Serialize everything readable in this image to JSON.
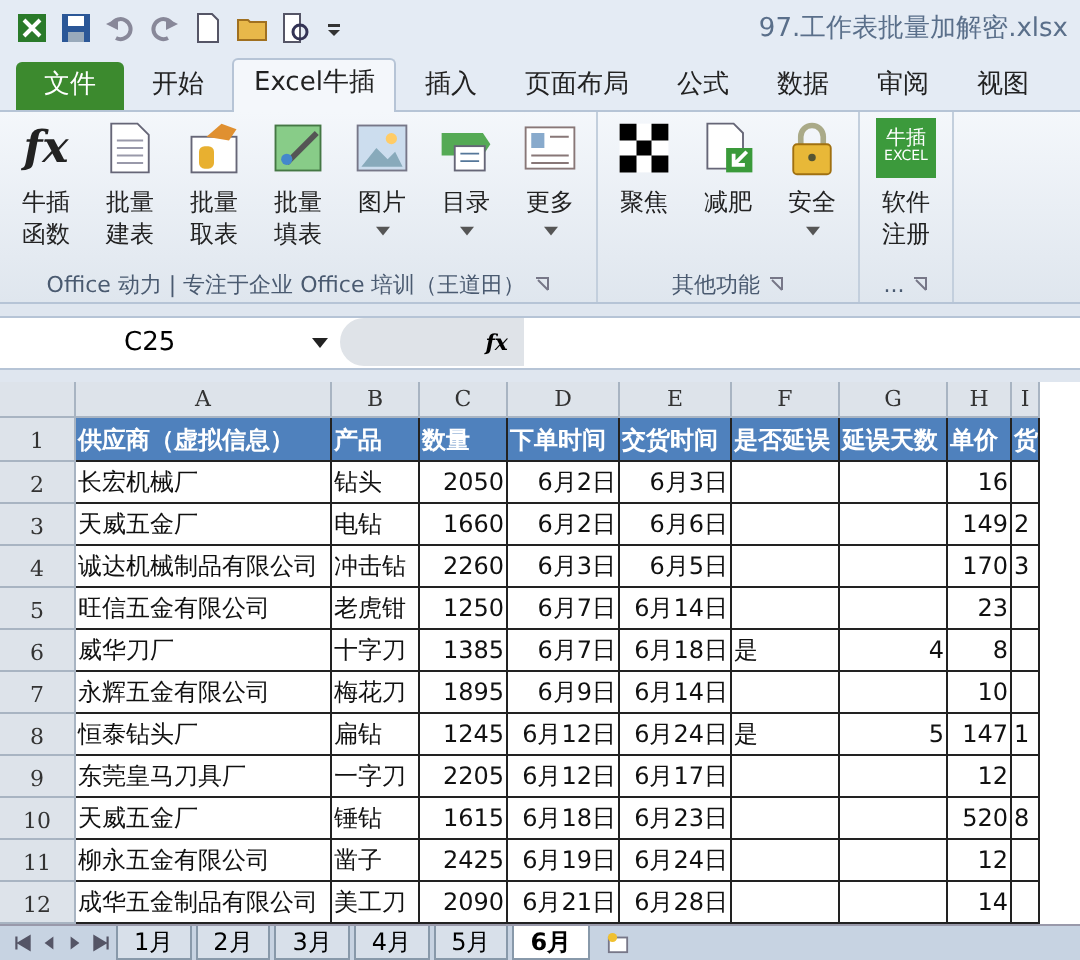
{
  "window": {
    "title": "97.工作表批量加解密.xlsx"
  },
  "tabs": [
    {
      "label": "文件",
      "kind": "file",
      "selected": false
    },
    {
      "label": "开始",
      "kind": "tab",
      "selected": false
    },
    {
      "label": "Excel牛插",
      "kind": "tab",
      "selected": true
    },
    {
      "label": "插入",
      "kind": "tab",
      "selected": false
    },
    {
      "label": "页面布局",
      "kind": "tab",
      "selected": false
    },
    {
      "label": "公式",
      "kind": "tab",
      "selected": false
    },
    {
      "label": "数据",
      "kind": "tab",
      "selected": false
    },
    {
      "label": "审阅",
      "kind": "tab",
      "selected": false
    },
    {
      "label": "视图",
      "kind": "tab",
      "selected": false
    }
  ],
  "ribbon": {
    "groups": [
      {
        "label": "Office 动力 | 专注于企业 Office 培训（王道田）",
        "buttons": [
          {
            "lines": [
              "牛插",
              "函数"
            ],
            "icon_text": "fx",
            "dropdown": false
          },
          {
            "lines": [
              "批量",
              "建表"
            ],
            "dropdown": false
          },
          {
            "lines": [
              "批量",
              "取表"
            ],
            "dropdown": false
          },
          {
            "lines": [
              "批量",
              "填表"
            ],
            "dropdown": false
          },
          {
            "lines": [
              "图片"
            ],
            "dropdown": true
          },
          {
            "lines": [
              "目录"
            ],
            "dropdown": true
          },
          {
            "lines": [
              "更多"
            ],
            "dropdown": true
          }
        ]
      },
      {
        "label": "其他功能",
        "buttons": [
          {
            "lines": [
              "聚焦"
            ],
            "dropdown": false
          },
          {
            "lines": [
              "减肥"
            ],
            "dropdown": false
          },
          {
            "lines": [
              "安全"
            ],
            "dropdown": true
          }
        ]
      },
      {
        "label": "...",
        "buttons": [
          {
            "lines": [
              "软件",
              "注册"
            ],
            "logo_text": [
              "牛插",
              "EXCEL"
            ],
            "dropdown": false
          }
        ]
      }
    ]
  },
  "formula_bar": {
    "name_box": "C25",
    "fx": "fx"
  },
  "sheet": {
    "columns": [
      "A",
      "B",
      "C",
      "D",
      "E",
      "F",
      "G",
      "H",
      "I"
    ],
    "header": [
      "供应商（虚拟信息）",
      "产品",
      "数量",
      "下单时间",
      "交货时间",
      "是否延误",
      "延误天数",
      "单价",
      "货"
    ],
    "header_number": "1",
    "rows": [
      {
        "number": "2",
        "cells": [
          "长宏机械厂",
          "钻头",
          "2050",
          "6月2日",
          "6月3日",
          "",
          "",
          "16",
          ""
        ]
      },
      {
        "number": "3",
        "cells": [
          "天威五金厂",
          "电钻",
          "1660",
          "6月2日",
          "6月6日",
          "",
          "",
          "149",
          "2"
        ]
      },
      {
        "number": "4",
        "cells": [
          "诚达机械制品有限公司",
          "冲击钻",
          "2260",
          "6月3日",
          "6月5日",
          "",
          "",
          "170",
          "3"
        ]
      },
      {
        "number": "5",
        "cells": [
          "旺信五金有限公司",
          "老虎钳",
          "1250",
          "6月7日",
          "6月14日",
          "",
          "",
          "23",
          ""
        ]
      },
      {
        "number": "6",
        "cells": [
          "威华刀厂",
          "十字刀",
          "1385",
          "6月7日",
          "6月18日",
          "是",
          "4",
          "8",
          ""
        ]
      },
      {
        "number": "7",
        "cells": [
          "永辉五金有限公司",
          "梅花刀",
          "1895",
          "6月9日",
          "6月14日",
          "",
          "",
          "10",
          ""
        ]
      },
      {
        "number": "8",
        "cells": [
          "恒泰钻头厂",
          "扁钻",
          "1245",
          "6月12日",
          "6月24日",
          "是",
          "5",
          "147",
          "1"
        ]
      },
      {
        "number": "9",
        "cells": [
          "东莞皇马刀具厂",
          "一字刀",
          "2205",
          "6月12日",
          "6月17日",
          "",
          "",
          "12",
          ""
        ]
      },
      {
        "number": "10",
        "cells": [
          "天威五金厂",
          "锤钻",
          "1615",
          "6月18日",
          "6月23日",
          "",
          "",
          "520",
          "8"
        ]
      },
      {
        "number": "11",
        "cells": [
          "柳永五金有限公司",
          "凿子",
          "2425",
          "6月19日",
          "6月24日",
          "",
          "",
          "12",
          ""
        ]
      },
      {
        "number": "12",
        "cells": [
          "成华五金制品有限公司",
          "美工刀",
          "2090",
          "6月21日",
          "6月28日",
          "",
          "",
          "14",
          ""
        ]
      }
    ]
  },
  "sheet_tabs": [
    {
      "label": "1月",
      "selected": false
    },
    {
      "label": "2月",
      "selected": false
    },
    {
      "label": "3月",
      "selected": false
    },
    {
      "label": "4月",
      "selected": false
    },
    {
      "label": "5月",
      "selected": false
    },
    {
      "label": "6月",
      "selected": true
    }
  ]
}
